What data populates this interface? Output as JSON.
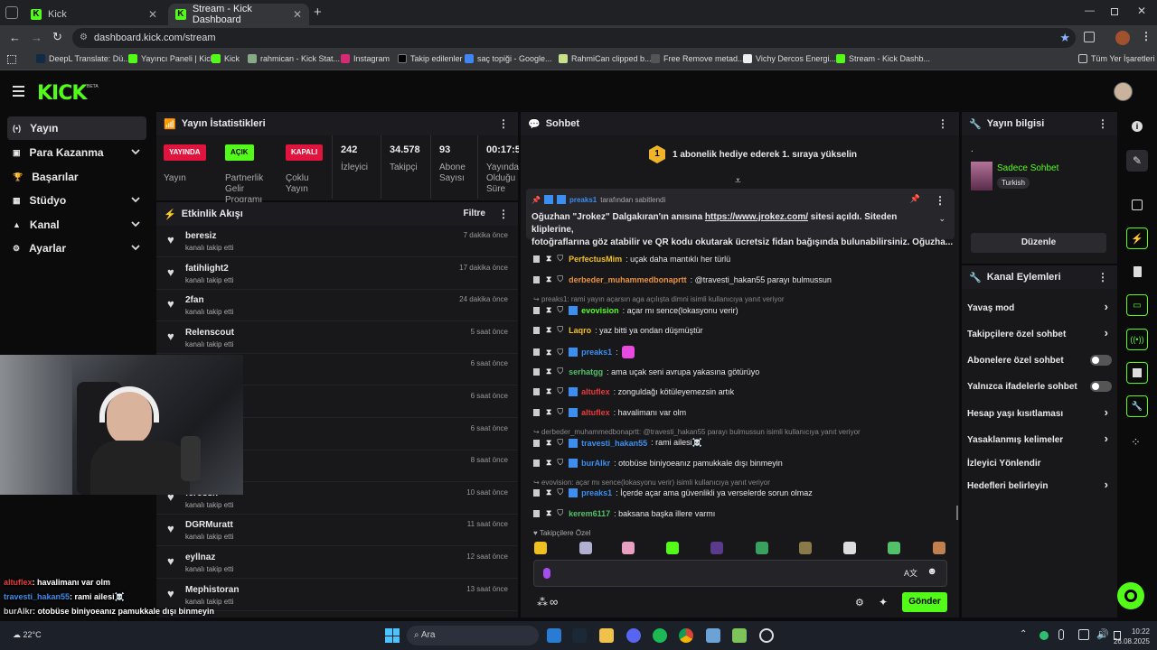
{
  "browser": {
    "tabs": [
      {
        "title": "Kick"
      },
      {
        "title": "Stream - Kick Dashboard"
      }
    ],
    "url": "dashboard.kick.com/stream",
    "bookmarks": [
      "DeepL Translate: Dü...",
      "Yayıncı Paneli | Kick",
      "Kick",
      "rahmican - Kick Stat...",
      "Instagram",
      "Takip edilenler",
      "saç topiği - Google...",
      "RahmiCan clipped b...",
      "Free Remove metad...",
      "Vichy Dercos Energi...",
      "Stream - Kick Dashb..."
    ],
    "all_bookmarks": "Tüm Yer İşaretleri"
  },
  "kick": {
    "logo": "KICK",
    "beta": "BETA",
    "accent": "#53fc18"
  },
  "sidebar": {
    "items": [
      {
        "label": "Yayın"
      },
      {
        "label": "Para Kazanma"
      },
      {
        "label": "Başarılar"
      },
      {
        "label": "Stüdyo"
      },
      {
        "label": "Kanal"
      },
      {
        "label": "Ayarlar"
      }
    ]
  },
  "stats": {
    "title": "Yayın İstatistikleri",
    "items": [
      {
        "badge": "YAYINDA",
        "label": "Yayın"
      },
      {
        "badge": "AÇIK",
        "label": "Partnerlik Gelir Programı"
      },
      {
        "badge": "KAPALI",
        "label": "Çoklu Yayın"
      },
      {
        "value": "242",
        "label": "İzleyici"
      },
      {
        "value": "34.578",
        "label": "Takipçi"
      },
      {
        "value": "93",
        "label": "Abone Sayısı"
      },
      {
        "value": "00:17:5",
        "label": "Yayında Olduğu Süre"
      }
    ]
  },
  "feed": {
    "title": "Etkinlik Akışı",
    "filter": "Filtre",
    "items": [
      {
        "name": "beresiz",
        "sub": "kanalı takip etti",
        "time": "7 dakika önce"
      },
      {
        "name": "fatihlight2",
        "sub": "kanalı takip etti",
        "time": "17 dakika önce"
      },
      {
        "name": "2fan",
        "sub": "kanalı takip etti",
        "time": "24 dakika önce"
      },
      {
        "name": "Relenscout",
        "sub": "kanalı takip etti",
        "time": "5 saat önce"
      },
      {
        "name": "",
        "sub": "",
        "time": "6 saat önce"
      },
      {
        "name": "",
        "sub": "",
        "time": "6 saat önce"
      },
      {
        "name": "",
        "sub": "",
        "time": "6 saat önce"
      },
      {
        "name": "",
        "sub": "",
        "time": "8 saat önce"
      },
      {
        "name": "ferossn",
        "sub": "kanalı takip etti",
        "time": "10 saat önce"
      },
      {
        "name": "DGRMuratt",
        "sub": "kanalı takip etti",
        "time": "11 saat önce"
      },
      {
        "name": "eyllnaz",
        "sub": "kanalı takip etti",
        "time": "12 saat önce"
      },
      {
        "name": "Mephistoran",
        "sub": "kanalı takip etti",
        "time": "13 saat önce"
      }
    ]
  },
  "chat": {
    "title": "Sohbet",
    "gift_banner": "1 abonelik hediye ederek 1. sıraya yükselin",
    "gift_rank": "1",
    "pinned_by_user": "preaks1",
    "pinned_by_text": "tarafından sabitlendi",
    "pinned_text_1": "Oğuzhan \"Jrokez\" Dalgakıran'ın anısına",
    "pinned_link": "https://www.jrokez.com/",
    "pinned_text_2": "sitesi açıldı. Siteden kliplerine,",
    "pinned_text_3": "fotoğraflarına göz atabilir ve QR kodu okutarak ücretsiz fidan bağışında bulunabilirsiniz. Oğuzha...",
    "messages": [
      {
        "user": "PerfectusMim",
        "color": "#f0c020",
        "text": ": uçak daha mantıklı her türlü"
      },
      {
        "user": "derbeder_muhammedbonaprtt",
        "color": "#e8913a",
        "text": ": @travesti_hakan55 parayı bulmussun"
      },
      {
        "reply": "preaks1: rami yayın açarsın aga açılışta dimni isimli kullanıcıya yanıt veriyor"
      },
      {
        "user": "evovision",
        "color": "#53fc18",
        "text": ": açar mı sence(lokasyonu verir)"
      },
      {
        "user": "Laqro",
        "color": "#f0c020",
        "text": ": yaz bitti ya ondan düşmüştür"
      },
      {
        "user": "preaks1",
        "color": "#3a8ff0",
        "text": ":"
      },
      {
        "user": "serhatgg",
        "color": "#53c06a",
        "text": ": ama uçak seni avrupa yakasına götürüyo"
      },
      {
        "user": "altuflex",
        "color": "#e83a3a",
        "text": ": zonguldağı kötüleyemezsin artık"
      },
      {
        "user": "altuflex",
        "color": "#e83a3a",
        "text": ": havalimanı var olm"
      },
      {
        "reply": "derbeder_muhammedbonaprtt: @travesti_hakan55 parayı bulmussun isimli kullanıcıya yanıt veriyor"
      },
      {
        "user": "travesti_hakan55",
        "color": "#3a8ff0",
        "text": ": rami ailesi☠️"
      },
      {
        "user": "burAlkr",
        "color": "#3a8ff0",
        "text": ": otobüse biniyoeanız pamukkale dışı binmeyin"
      },
      {
        "reply": "evovision: açar mı sence(lokasyonu verir) isimli kullanıcıya yanıt veriyor"
      },
      {
        "user": "preaks1",
        "color": "#3a8ff0",
        "text": ": İçerde açar ama güvenlikli ya verselerde sorun olmaz"
      },
      {
        "user": "kerem6117",
        "color": "#53c06a",
        "text": ": baksana başka illere varmı"
      }
    ],
    "followers_special": "Takipçilere Özel",
    "send": "Gönder"
  },
  "info": {
    "title": "Yayın bilgisi",
    "dot": ".",
    "category": "Sadece Sohbet",
    "language": "Turkish",
    "edit": "Düzenle"
  },
  "actions": {
    "title": "Kanal Eylemleri",
    "items": [
      {
        "label": "Yavaş mod",
        "kind": "chevron"
      },
      {
        "label": "Takipçilere özel sohbet",
        "kind": "chevron"
      },
      {
        "label": "Abonelere özel sohbet",
        "kind": "toggle"
      },
      {
        "label": "Yalnızca ifadelerle sohbet",
        "kind": "toggle"
      },
      {
        "label": "Hesap yaşı kısıtlaması",
        "kind": "chevron"
      },
      {
        "label": "Yasaklanmış kelimeler",
        "kind": "chevron"
      },
      {
        "label": "İzleyici Yönlendir",
        "kind": "none"
      },
      {
        "label": "Hedefleri belirleyin",
        "kind": "chevron"
      }
    ]
  },
  "overlay": [
    {
      "user": "altuflex",
      "color": "#e83a3a",
      "text": ": havalimanı var olm"
    },
    {
      "user": "travesti_hakan55",
      "color": "#3a8ff0",
      "text": ": rami ailesi☠️"
    },
    {
      "user": "burAlkr",
      "color": "#cfcfcf",
      "text": ": otobüse biniyoeanız pamukkale dışı binmeyin"
    },
    {
      "user": "preaks1",
      "color": "#3a8ff0",
      "text": ": İçerde açar ama güvenlikli ya verselerde sorun olmaz"
    },
    {
      "user": "kerem6117",
      "color": "#53c06a",
      "text": ": baksana başka illere varmı"
    }
  ],
  "taskbar": {
    "weather": "22°C",
    "search": "Ara",
    "time": "10:22",
    "date": "26.08.2025"
  }
}
